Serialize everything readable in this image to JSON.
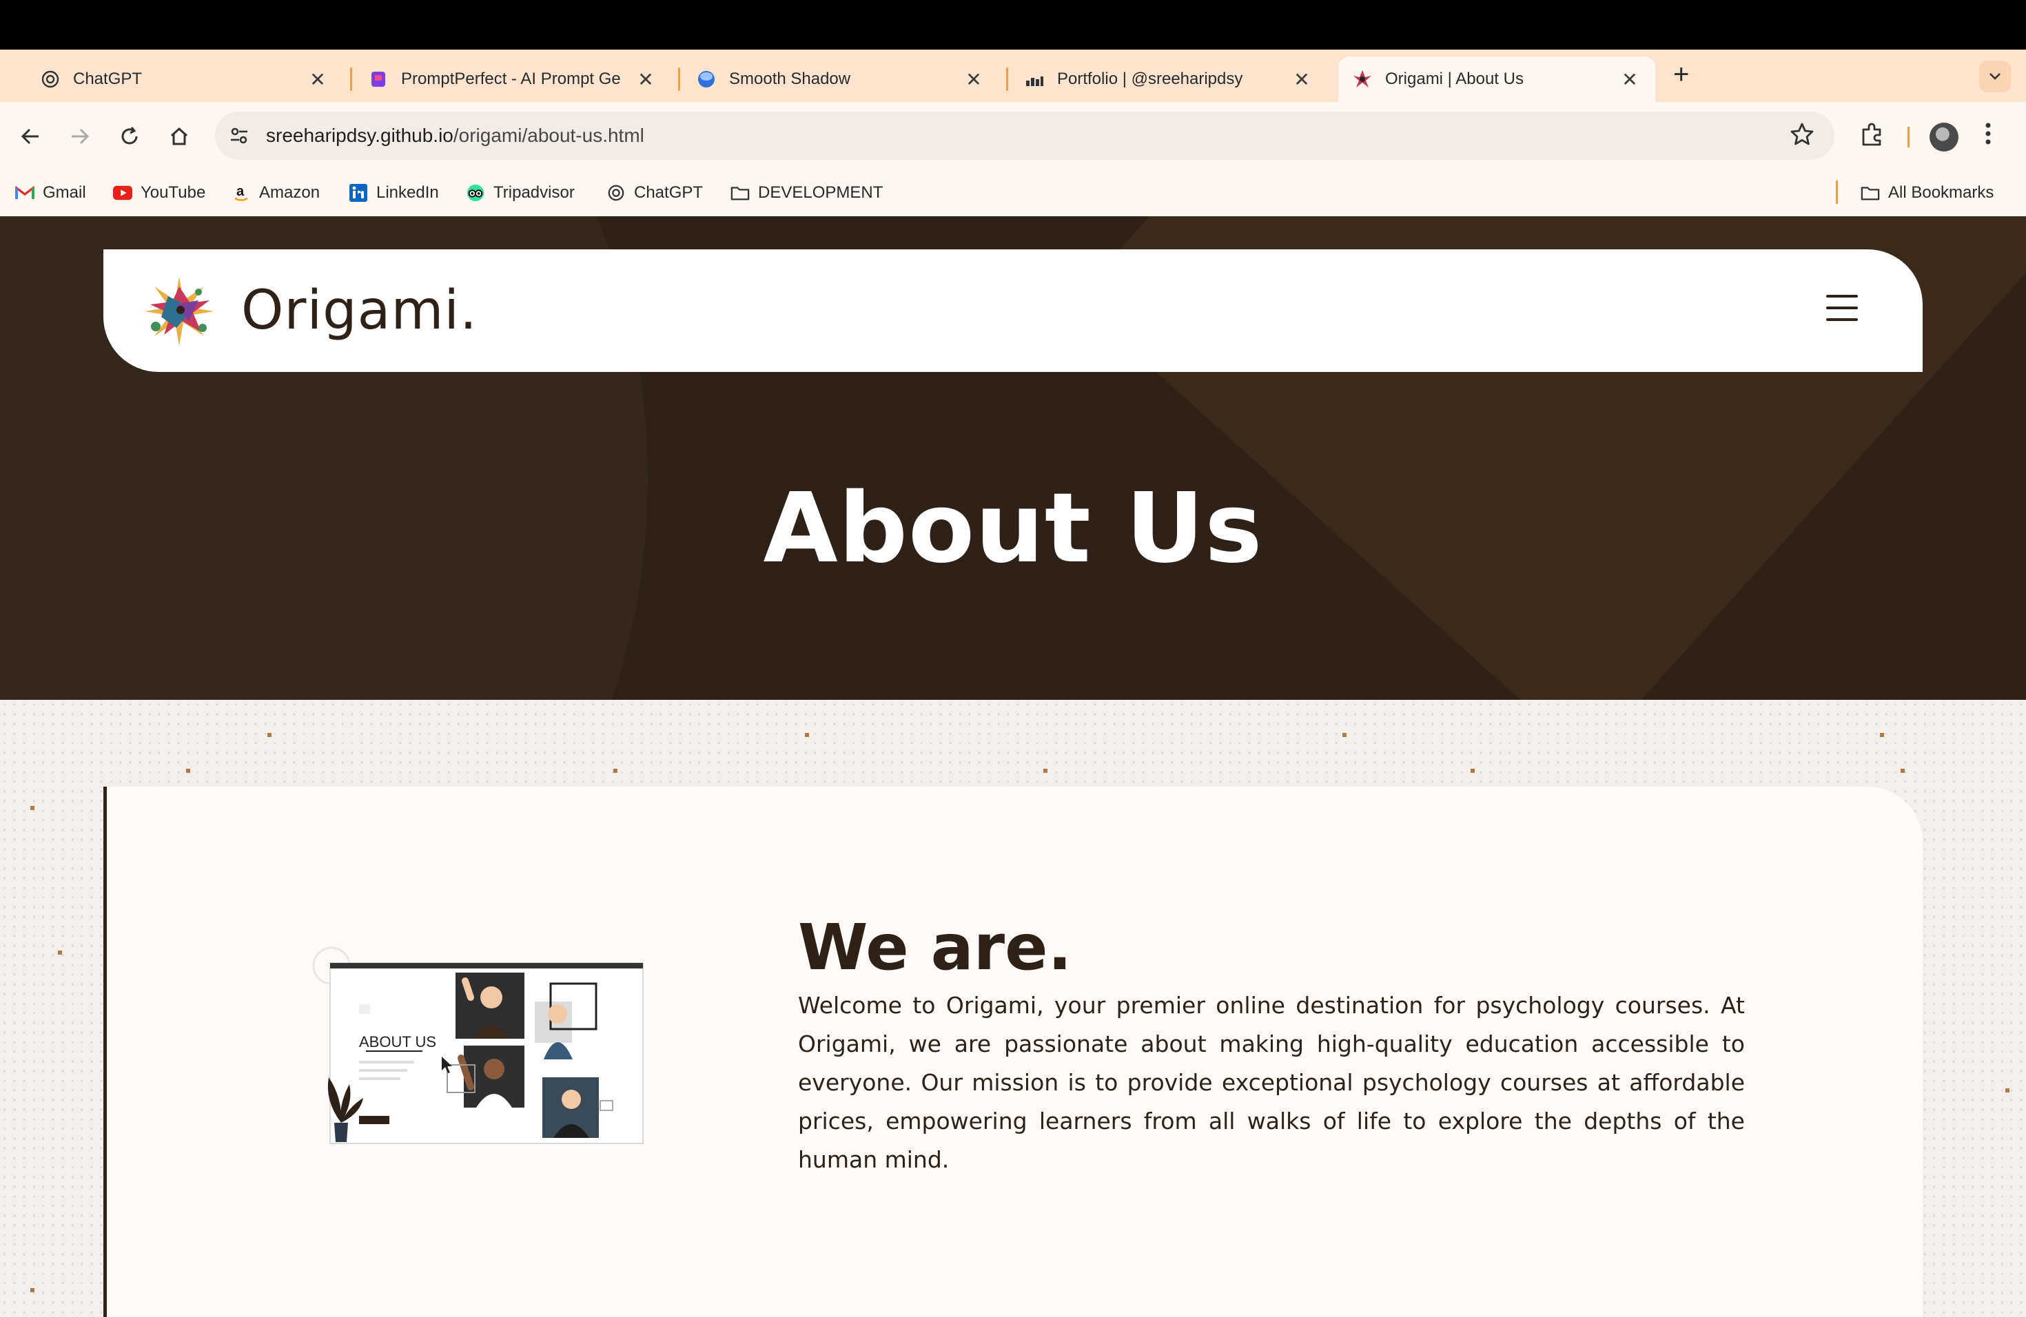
{
  "browser": {
    "tabs": [
      {
        "title": "ChatGPT",
        "icon": "chatgpt-icon",
        "active": false
      },
      {
        "title": "PromptPerfect - AI Prompt Ge",
        "icon": "promptperfect-icon",
        "active": false
      },
      {
        "title": "Smooth Shadow",
        "icon": "smooth-shadow-icon",
        "active": false
      },
      {
        "title": "Portfolio | @sreeharipdsy",
        "icon": "portfolio-icon",
        "active": false
      },
      {
        "title": "Origami | About Us",
        "icon": "origami-icon",
        "active": true
      }
    ],
    "close_glyph": "✕",
    "new_tab_glyph": "+",
    "address": {
      "domain": "sreeharipdsy.github.io",
      "path": "/origami/about-us.html"
    },
    "bookmarks": [
      {
        "label": "Gmail",
        "icon": "gmail-icon"
      },
      {
        "label": "YouTube",
        "icon": "youtube-icon"
      },
      {
        "label": "Amazon",
        "icon": "amazon-icon"
      },
      {
        "label": "LinkedIn",
        "icon": "linkedin-icon"
      },
      {
        "label": "Tripadvisor",
        "icon": "tripadvisor-icon"
      },
      {
        "label": "ChatGPT",
        "icon": "chatgpt-icon"
      },
      {
        "label": "DEVELOPMENT",
        "icon": "folder-icon"
      }
    ],
    "all_bookmarks": "All Bookmarks"
  },
  "page": {
    "brand": "Origami.",
    "hero_title": "About Us",
    "section_heading": "We are.",
    "illustration_label": "ABOUT US",
    "section_text": "Welcome to Origami, your premier online destination for psychology courses. At Origami, we are passionate about making high-quality education accessible to everyone. Our mission is to provide exceptional psychology courses at affordable prices, empowering learners from all walks of life to explore the depths of the human mind."
  },
  "colors": {
    "dark_brown": "#2e2218",
    "tab_strip": "#fde4cf",
    "accent_orange": "#e6a04b",
    "content_bg": "#f2efec"
  }
}
